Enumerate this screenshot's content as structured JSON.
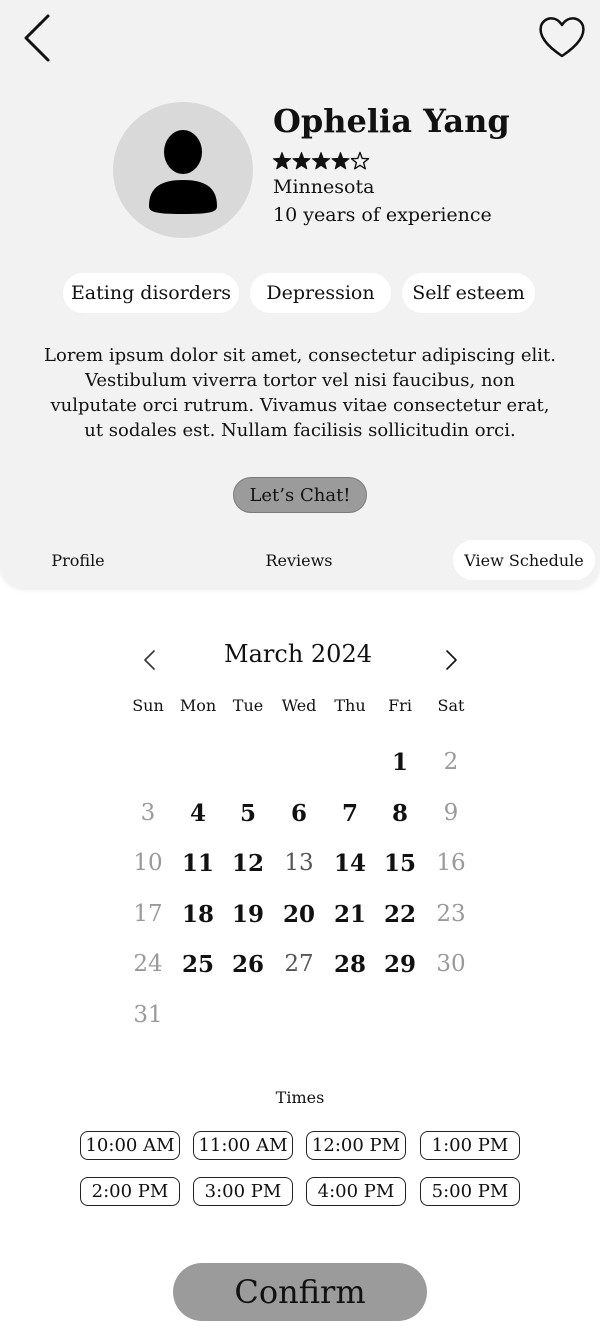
{
  "profile": {
    "name": "Ophelia Yang",
    "rating": 4,
    "rating_max": 5,
    "location": "Minnesota",
    "experience": "10 years of experience",
    "tags": [
      "Eating disorders",
      "Depression",
      "Self esteem"
    ],
    "bio": "Lorem ipsum dolor sit amet, consectetur adipiscing elit. Vestibulum viverra tortor vel nisi faucibus, non vulputate orci rutrum. Vivamus vitae consectetur erat, ut sodales est. Nullam facilisis sollicitudin orci.",
    "chat_label": "Let’s Chat!"
  },
  "icons": {
    "back": "chevron-left-icon",
    "favorite": "heart-outline-icon",
    "avatar": "person-silhouette-icon",
    "prev_month": "chevron-left-icon",
    "next_month": "chevron-right-icon"
  },
  "tabs": [
    {
      "label": "Profile",
      "active": false
    },
    {
      "label": "Reviews",
      "active": false
    },
    {
      "label": "View Schedule",
      "active": true
    }
  ],
  "calendar": {
    "month_label": "March 2024",
    "weekdays": [
      "Sun",
      "Mon",
      "Tue",
      "Wed",
      "Thu",
      "Fri",
      "Sat"
    ],
    "first_weekday_index": 5,
    "days_in_month": 31,
    "available_days": [
      1,
      4,
      5,
      6,
      7,
      8,
      11,
      12,
      14,
      15,
      18,
      19,
      20,
      21,
      22,
      25,
      26,
      28,
      29
    ],
    "unavailable_weekdays": [
      13,
      27
    ]
  },
  "times": {
    "label": "Times",
    "slots": [
      "10:00 AM",
      "11:00 AM",
      "12:00 PM",
      "1:00 PM",
      "2:00 PM",
      "3:00 PM",
      "4:00 PM",
      "5:00 PM"
    ]
  },
  "confirm_label": "Confirm",
  "colors": {
    "panel_bg": "#f2f2f2",
    "button_gray": "#9b9b9b",
    "disabled_day": "#9a9a9a"
  }
}
